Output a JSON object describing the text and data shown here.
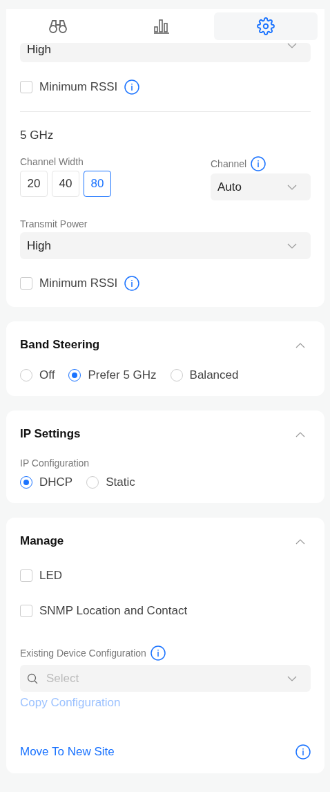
{
  "tabs": [
    {
      "kind": "binoculars",
      "selected": false
    },
    {
      "kind": "chart",
      "selected": false
    },
    {
      "kind": "settings",
      "selected": true
    }
  ],
  "radio_card": {
    "top_select": {
      "value": "High"
    },
    "top_min_rssi": {
      "label": "Minimum RSSI",
      "checked": false
    },
    "band_title": "5 GHz",
    "channel_width": {
      "label": "Channel Width",
      "options": [
        {
          "label": "20",
          "selected": false
        },
        {
          "label": "40",
          "selected": false
        },
        {
          "label": "80",
          "selected": true
        }
      ]
    },
    "channel": {
      "label": "Channel",
      "value": "Auto"
    },
    "transmit_power": {
      "label": "Transmit Power",
      "value": "High"
    },
    "min_rssi": {
      "label": "Minimum RSSI",
      "checked": false
    }
  },
  "band_steering": {
    "title": "Band Steering",
    "expanded": true,
    "options": [
      {
        "label": "Off",
        "selected": false
      },
      {
        "label": "Prefer 5 GHz",
        "selected": true
      },
      {
        "label": "Balanced",
        "selected": false
      }
    ]
  },
  "ip_settings": {
    "title": "IP Settings",
    "expanded": true,
    "label": "IP Configuration",
    "options": [
      {
        "label": "DHCP",
        "selected": true
      },
      {
        "label": "Static",
        "selected": false
      }
    ]
  },
  "manage": {
    "title": "Manage",
    "expanded": true,
    "checkboxes": [
      {
        "label": "LED",
        "checked": false
      },
      {
        "label": "SNMP Location and Contact",
        "checked": false
      }
    ],
    "existing_config": {
      "label": "Existing Device Configuration",
      "placeholder": "Select"
    },
    "copy_link": {
      "label": "Copy Configuration",
      "disabled": true
    },
    "move_link": {
      "label": "Move To New Site"
    }
  }
}
